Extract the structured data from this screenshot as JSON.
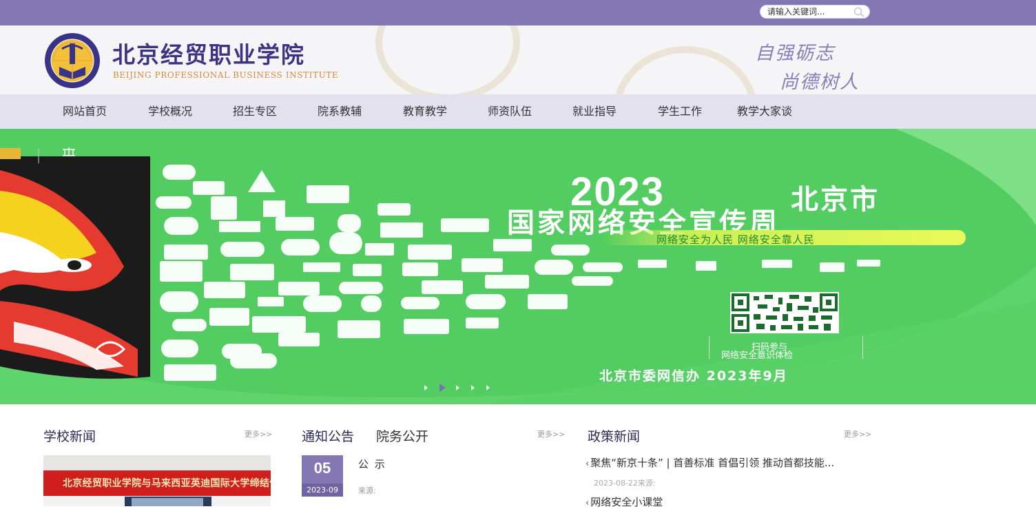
{
  "search": {
    "placeholder": "请输入关键词..."
  },
  "header": {
    "school_name_cn": "北京经贸职业学院",
    "school_name_en": "BEIJING PROFESSIONAL BUSINESS INSTITUTE",
    "motto_line1": "自强砺志",
    "motto_line2": "尚德树人"
  },
  "nav": [
    {
      "label": "网站首页"
    },
    {
      "label": "学校概况"
    },
    {
      "label": "招生专区"
    },
    {
      "label": "院系教辅"
    },
    {
      "label": "教育教学"
    },
    {
      "label": "师资队伍"
    },
    {
      "label": "就业指导"
    },
    {
      "label": "学生工作"
    },
    {
      "label": "教学大家谈"
    }
  ],
  "banner": {
    "year": "2023",
    "city": "北京市",
    "title": "国家网络安全宣传周",
    "slogan": "网络安全为人民 网络安全靠人民",
    "scan_line1": "扫码参与",
    "scan_line2": "网络安全意识体检",
    "signature": "北京市委网信办 2023年9月",
    "active_slide": 2,
    "slide_count": 5
  },
  "sections": {
    "news": {
      "title": "学校新闻",
      "more": "更多>>",
      "image_banner_text": "北京经贸职业学院与马来西亚英迪国际大学缔结伙伴学校签约"
    },
    "notice": {
      "tab_active": "通知公告",
      "tab_other": "院务公开",
      "more": "更多>>",
      "item": {
        "day": "05",
        "year_month": "2023-09",
        "title": "公 示",
        "source": "来源:"
      }
    },
    "policy": {
      "title": "政策新闻",
      "more": "更多>>",
      "items": [
        {
          "title": "聚焦“新京十条” | 首善标准 首倡引领 推动首都技能...",
          "meta": "2023-08-22来源:"
        },
        {
          "title": "网络安全小课堂",
          "meta": ""
        }
      ]
    }
  },
  "colors": {
    "brand_purple": "#8378b4",
    "nav_bg": "#e4e1ee",
    "banner_green": "#53cd61"
  }
}
